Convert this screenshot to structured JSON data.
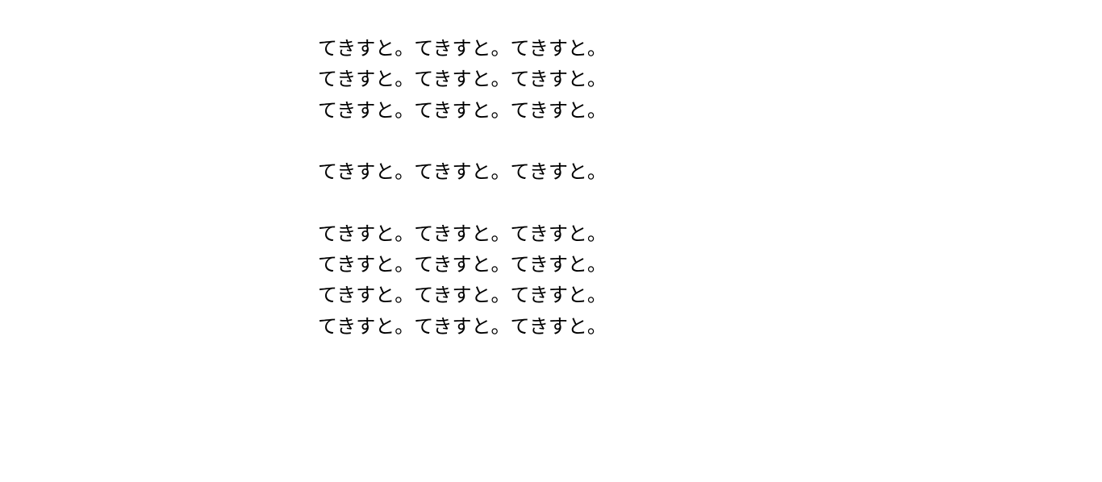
{
  "paragraphs": [
    {
      "lines": [
        "てきすと。てきすと。てきすと。",
        "てきすと。てきすと。てきすと。",
        "てきすと。てきすと。てきすと。"
      ]
    },
    {
      "lines": [
        "てきすと。てきすと。てきすと。"
      ]
    },
    {
      "lines": [
        "てきすと。てきすと。てきすと。",
        "てきすと。てきすと。てきすと。",
        "てきすと。てきすと。てきすと。",
        "てきすと。てきすと。てきすと。"
      ]
    }
  ]
}
